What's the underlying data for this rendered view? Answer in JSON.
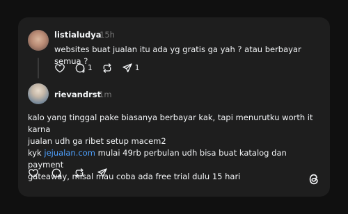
{
  "post1": {
    "username": "listialudya",
    "time": "15h",
    "text": "websites buat jualan itu ada yg gratis ga yah ? atau berbayar semua ?",
    "reply_count": "1",
    "share_count": "1"
  },
  "post2": {
    "username": "rievandrst",
    "time": "1m",
    "line1": "kalo yang tinggal pake biasanya berbayar kak, tapi menurutku worth it karna",
    "line2": "jualan udh ga ribet setup macem2",
    "line3_prefix": "kyk ",
    "line3_link": "jejualan.com",
    "line3_suffix": " mulai 49rb perbulan udh bisa buat katalog dan payment",
    "line4": "gateaway, misal mau coba ada free trial dulu 15 hari"
  },
  "colors": {
    "background": "#101010",
    "card": "#1e1e1e",
    "link": "#4ea1ff",
    "muted": "#777777"
  },
  "icons": [
    "heart-icon",
    "reply-icon",
    "repost-icon",
    "share-icon",
    "threads-logo-icon"
  ]
}
